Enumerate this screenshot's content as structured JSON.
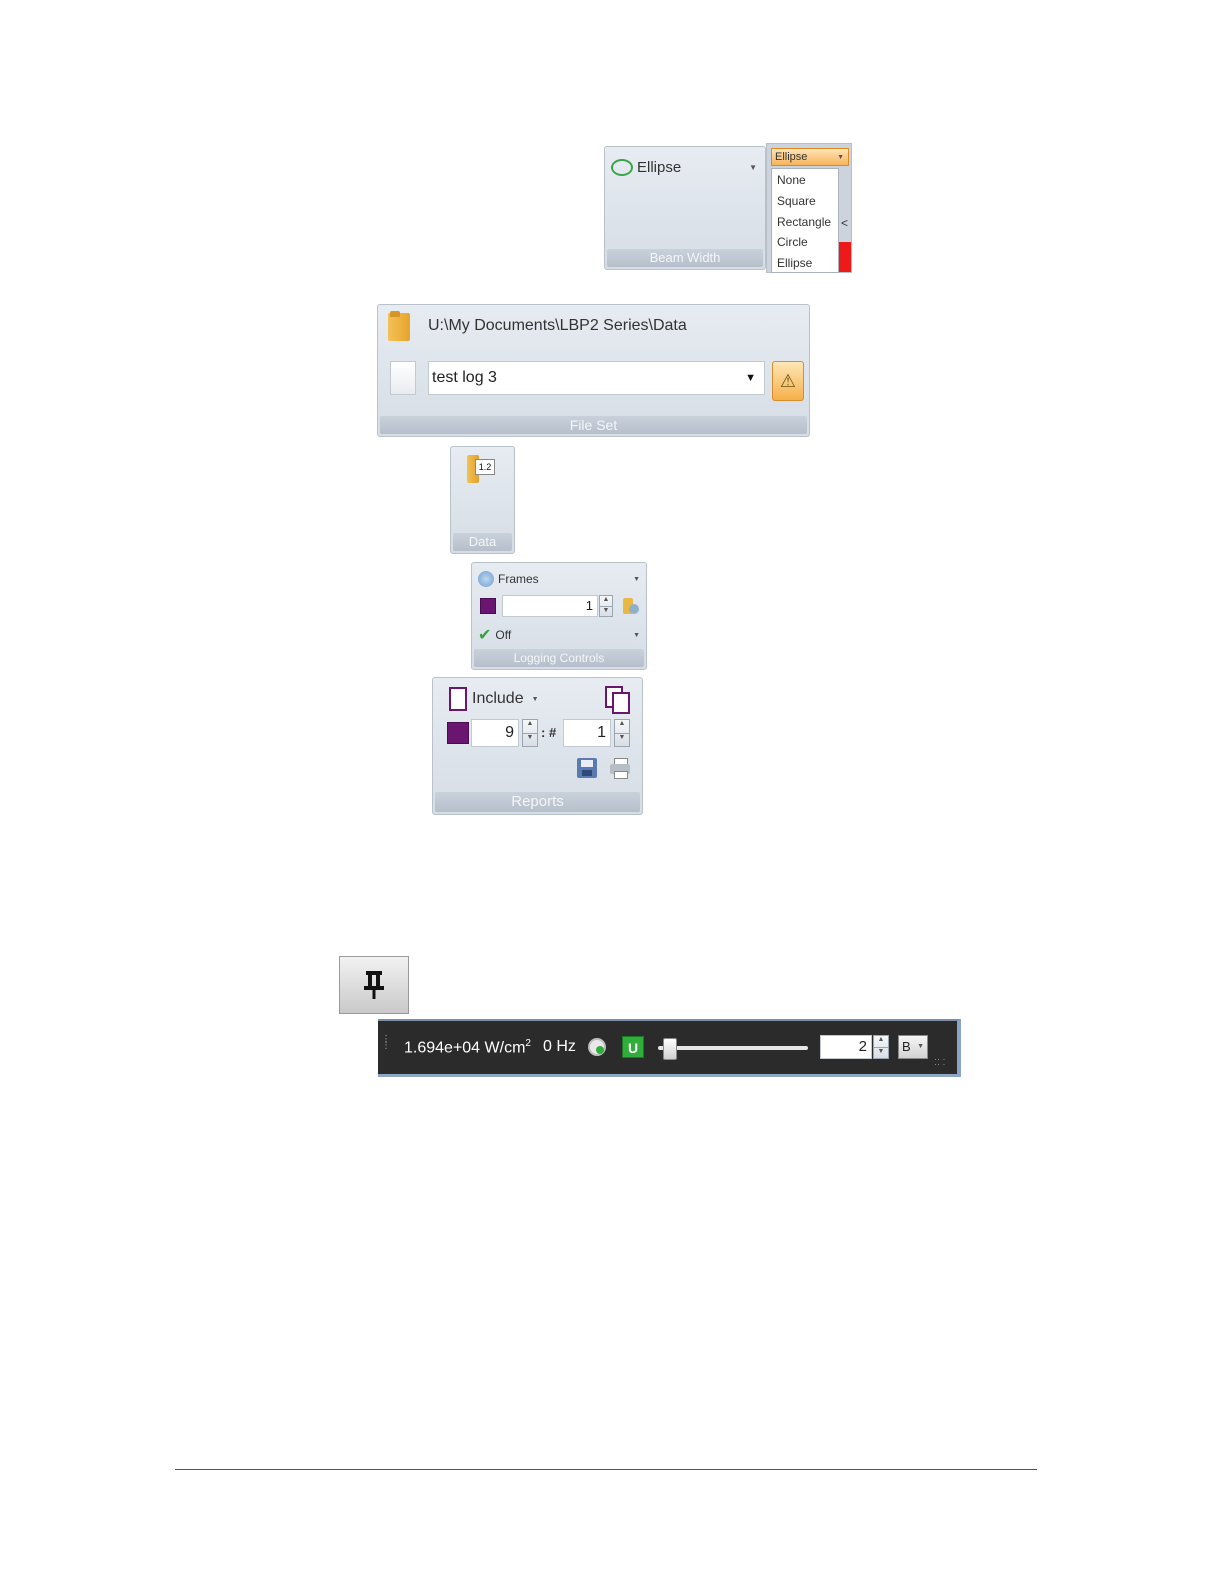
{
  "beam_width": {
    "selected_shape": "Ellipse",
    "caption": "Beam Width",
    "dropdown": {
      "current": "Ellipse",
      "options": [
        "None",
        "Square",
        "Rectangle",
        "Circle",
        "Ellipse"
      ]
    }
  },
  "file_set": {
    "path": "U:\\My Documents\\LBP2 Series\\Data",
    "file_name": "test log 3",
    "caption": "File Set"
  },
  "data_group": {
    "icon_text": "1.2",
    "caption": "Data"
  },
  "logging_controls": {
    "mode": "Frames",
    "count": "1",
    "state": "Off",
    "caption": "Logging Controls"
  },
  "reports": {
    "include_label": "Include",
    "value_a": "9",
    "separator": ": #",
    "value_b": "1",
    "caption": "Reports"
  },
  "status_bar": {
    "power_density_value": "1.694e+04 W/cm",
    "power_density_exponent": "2",
    "frequency": "0 Hz",
    "u_badge": "U",
    "slider_fraction": 0.04,
    "spin_value": "2",
    "unit_select": "B"
  },
  "colors": {
    "swatch": "#6a1570",
    "status_bar_bg": "#2b2b2b",
    "u_badge": "#2fae3a",
    "highlight": "#f6a93b"
  }
}
